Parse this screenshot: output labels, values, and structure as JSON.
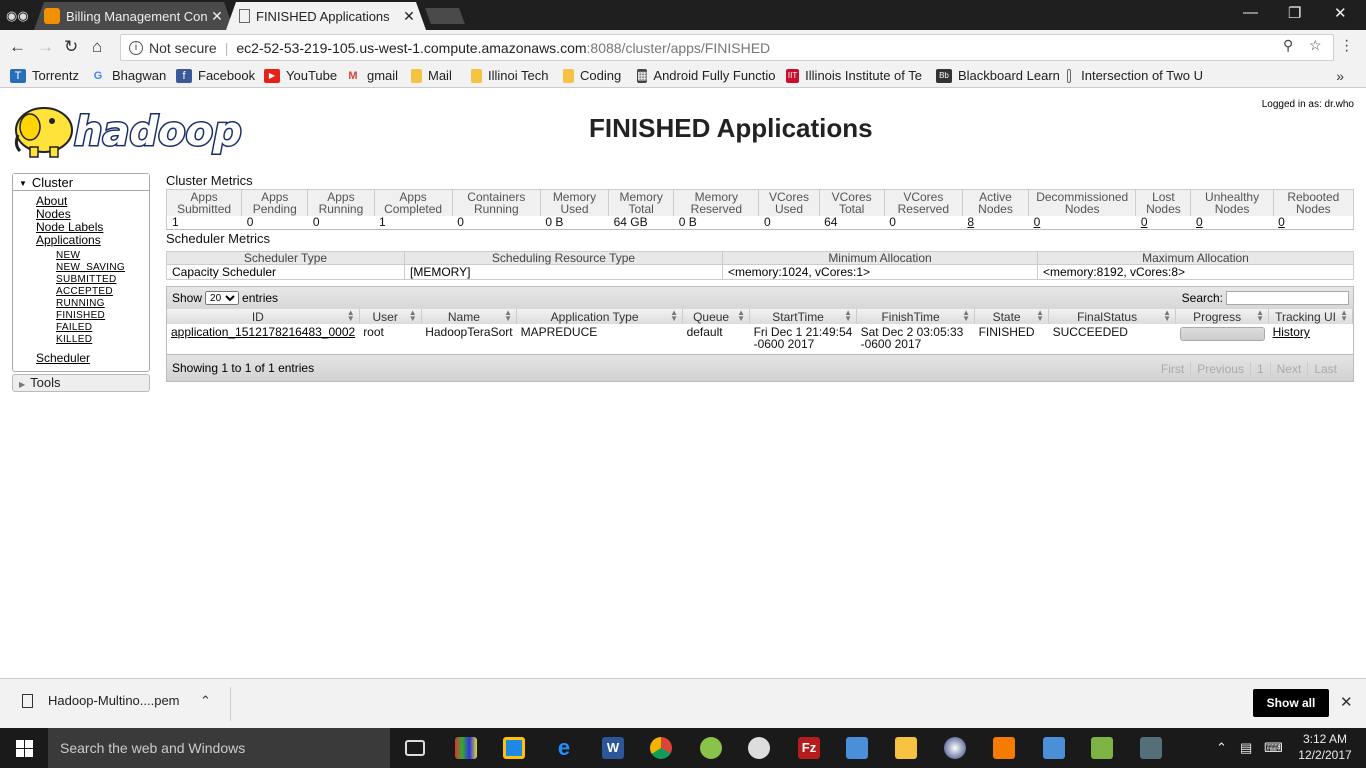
{
  "browser": {
    "tabs": [
      {
        "title": "Billing Management Con",
        "active": false
      },
      {
        "title": "FINISHED Applications",
        "active": true
      }
    ],
    "not_secure": "Not secure",
    "url_host": "ec2-52-53-219-105.us-west-1.compute.amazonaws.com",
    "url_path": ":8088/cluster/apps/FINISHED",
    "bookmarks": [
      {
        "label": "Torrentz",
        "icon": "t-icon",
        "color": "#2a6ebb"
      },
      {
        "label": "Bhagwan",
        "icon": "google-icon",
        "color": "#ffffff"
      },
      {
        "label": "Facebook",
        "icon": "facebook-icon",
        "color": "#3b5998"
      },
      {
        "label": "YouTube",
        "icon": "youtube-icon",
        "color": "#e62117"
      },
      {
        "label": "gmail",
        "icon": "gmail-icon",
        "color": "#d44638"
      },
      {
        "label": "Mail",
        "icon": "folder-icon",
        "color": "#f5c242"
      },
      {
        "label": "Illinoi Tech",
        "icon": "folder-icon",
        "color": "#f5c242"
      },
      {
        "label": "Coding",
        "icon": "folder-icon",
        "color": "#f5c242"
      },
      {
        "label": "Android Fully Functio",
        "icon": "android-icon",
        "color": "#444444"
      },
      {
        "label": "Illinois Institute of Te",
        "icon": "iit-icon",
        "color": "#c8102e"
      },
      {
        "label": "Blackboard Learn",
        "icon": "blackboard-icon",
        "color": "#333333"
      },
      {
        "label": "Intersection of Two U",
        "icon": "page-icon",
        "color": "#ffffff"
      }
    ]
  },
  "header": {
    "logged_in": "Logged in as: dr.who",
    "title": "FINISHED Applications",
    "logo_text": "hadoop"
  },
  "sidebar": {
    "cluster_label": "Cluster",
    "links": [
      "About",
      "Nodes",
      "Node Labels",
      "Applications"
    ],
    "app_states": [
      "NEW",
      "NEW_SAVING",
      "SUBMITTED",
      "ACCEPTED",
      "RUNNING",
      "FINISHED",
      "FAILED",
      "KILLED"
    ],
    "scheduler": "Scheduler",
    "tools": "Tools"
  },
  "cluster_metrics": {
    "title": "Cluster Metrics",
    "headers": [
      [
        "Apps",
        "Submitted"
      ],
      [
        "Apps",
        "Pending"
      ],
      [
        "Apps",
        "Running"
      ],
      [
        "Apps",
        "Completed"
      ],
      [
        "Containers",
        "Running"
      ],
      [
        "Memory",
        "Used"
      ],
      [
        "Memory",
        "Total"
      ],
      [
        "Memory",
        "Reserved"
      ],
      [
        "VCores",
        "Used"
      ],
      [
        "VCores",
        "Total"
      ],
      [
        "VCores",
        "Reserved"
      ],
      [
        "Active",
        "Nodes"
      ],
      [
        "Decommissioned",
        "Nodes"
      ],
      [
        "Lost",
        "Nodes"
      ],
      [
        "Unhealthy",
        "Nodes"
      ],
      [
        "Rebooted",
        "Nodes"
      ]
    ],
    "values": [
      "1",
      "0",
      "0",
      "1",
      "0",
      "0 B",
      "64 GB",
      "0 B",
      "0",
      "64",
      "0",
      "8",
      "0",
      "0",
      "0",
      "0"
    ]
  },
  "scheduler_metrics": {
    "title": "Scheduler Metrics",
    "headers": [
      "Scheduler Type",
      "Scheduling Resource Type",
      "Minimum Allocation",
      "Maximum Allocation"
    ],
    "values": [
      "Capacity Scheduler",
      "[MEMORY]",
      "<memory:1024, vCores:1>",
      "<memory:8192, vCores:8>"
    ]
  },
  "apps_table": {
    "show_label": "Show",
    "page_size": "20",
    "entries_label": "entries",
    "search_label": "Search:",
    "columns": [
      "ID",
      "User",
      "Name",
      "Application Type",
      "Queue",
      "StartTime",
      "FinishTime",
      "State",
      "FinalStatus",
      "Progress",
      "Tracking UI"
    ],
    "rows": [
      {
        "id": "application_1512178216483_0002",
        "user": "root",
        "name": "HadoopTeraSort",
        "type": "MAPREDUCE",
        "queue": "default",
        "start1": "Fri Dec 1 21:49:54",
        "start2": "-0600 2017",
        "finish1": "Sat Dec 2 03:05:33",
        "finish2": "-0600 2017",
        "state": "FINISHED",
        "final_status": "SUCCEEDED",
        "progress": 1.0,
        "tracking": "History"
      }
    ],
    "info": "Showing 1 to 1 of 1 entries",
    "pager": [
      "First",
      "Previous",
      "1",
      "Next",
      "Last"
    ]
  },
  "download_bar": {
    "file": "Hadoop-Multino....pem",
    "show_all": "Show all"
  },
  "taskbar": {
    "search": "Search the web and Windows",
    "time": "3:12 AM",
    "date": "12/2/2017"
  }
}
